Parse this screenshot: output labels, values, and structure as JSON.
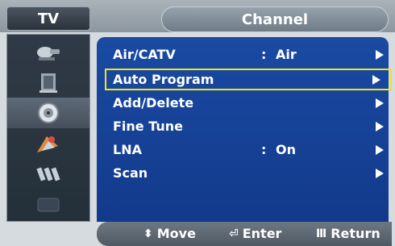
{
  "header": {
    "section_tab": "TV",
    "menu_title": "Channel"
  },
  "sidebar": {
    "icons": [
      {
        "name": "picture-icon"
      },
      {
        "name": "sound-icon"
      },
      {
        "name": "channel-icon",
        "selected": true
      },
      {
        "name": "setup-icon"
      },
      {
        "name": "input-icon"
      },
      {
        "name": "function-icon"
      }
    ]
  },
  "menu": {
    "items": [
      {
        "label": "Air/CATV",
        "colon": ":",
        "value": "Air"
      },
      {
        "label": "Auto Program",
        "highlighted": true
      },
      {
        "label": "Add/Delete"
      },
      {
        "label": "Fine Tune"
      },
      {
        "label": "LNA",
        "colon": ":",
        "value": "On"
      },
      {
        "label": "Scan"
      }
    ]
  },
  "help": {
    "move_label": "Move",
    "enter_label": "Enter",
    "return_label": "Return"
  },
  "colors": {
    "menu_bg": "#1a4aa3",
    "highlight_border": "#f0e41c",
    "text": "#ffffff"
  }
}
